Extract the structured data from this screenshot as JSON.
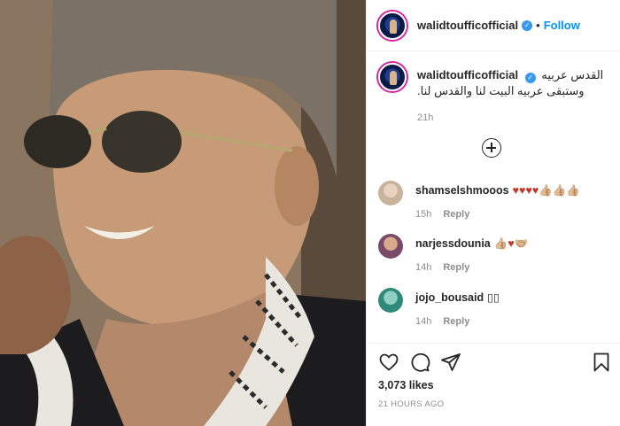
{
  "post": {
    "author": "walidtoufficofficial",
    "follow_label": "Follow",
    "separator": "•",
    "verified_mark": "✓",
    "caption_line1": "القدس عربيه",
    "caption_line2": "وستبقى عربيه البيت لنا والقدس لنا.",
    "caption_time": "21h",
    "likes": "3,073 likes",
    "posted_ago": "21 HOURS AGO"
  },
  "comments": [
    {
      "user": "shamselshmooos",
      "text": "♥♥♥♥👍🏼👍🏼👍🏼",
      "time": "15h",
      "reply": "Reply",
      "avatar_color": "#c9b39c"
    },
    {
      "user": "narjessdounia",
      "text": "👍🏼♥🤝🏼",
      "time": "14h",
      "reply": "Reply",
      "avatar_color": "#7a4a6a"
    },
    {
      "user": "jojo_bousaid",
      "text": "▯▯",
      "time": "14h",
      "reply": "Reply",
      "avatar_color": "#2f8a7a"
    }
  ],
  "icons": {
    "like": "heart-icon",
    "comment": "comment-icon",
    "share": "share-icon",
    "save": "bookmark-icon",
    "more": "add-circle-icon"
  },
  "colors": {
    "accent": "#0095f6",
    "verified": "#3897f0",
    "muted": "#8e8e8e",
    "text": "#262626"
  }
}
